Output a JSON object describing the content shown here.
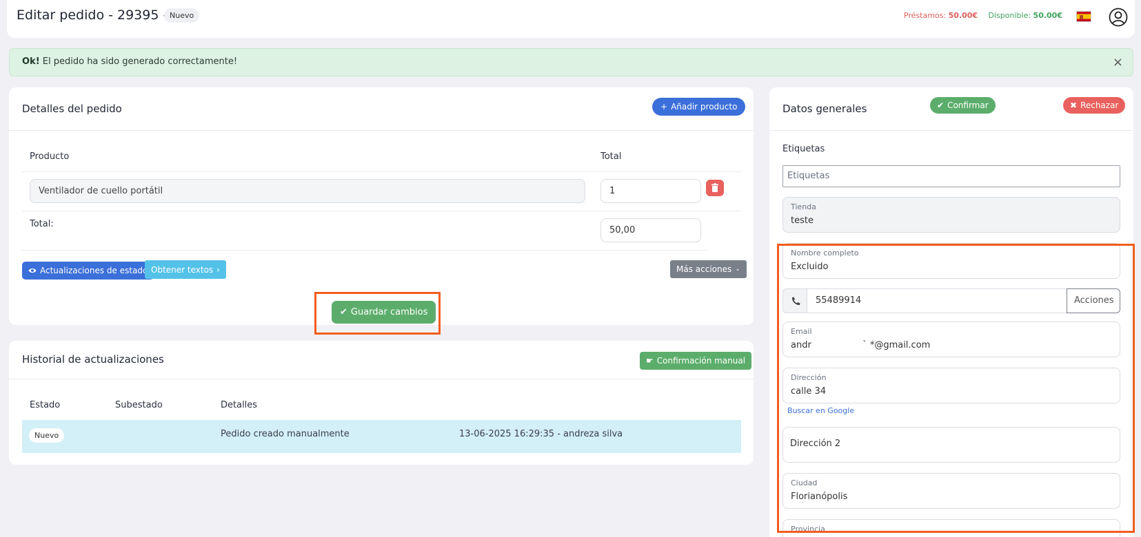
{
  "header": {
    "title": "Editar pedido - 29395 -",
    "status_badge": "Nuevo",
    "loans_label": "Préstamos:",
    "loans_value": "50.00€",
    "available_label": "Disponible:",
    "available_value": "50.00€",
    "flag_icon": "spain-flag-icon",
    "user_icon": "user-circle-icon"
  },
  "alert": {
    "strong": "Ok!",
    "message": "El pedido ha sido generado correctamente!",
    "close": "×"
  },
  "details": {
    "title": "Detalles del pedido",
    "add_product_label": "Añadir producto",
    "col_product": "Producto",
    "col_total": "Total",
    "product_name": "Ventilador de cuello portátil",
    "product_qty": "1",
    "total_label": "Total:",
    "total_value": "50,00",
    "status_updates_label": "Actualizaciones de estado",
    "get_texts_label": "Obtener textos",
    "more_actions_label": "Más acciones",
    "save_label": "Guardar cambios"
  },
  "history": {
    "title": "Historial de actualizaciones",
    "manual_confirm_label": "Confirmación manual",
    "col_state": "Estado",
    "col_substate": "Subestado",
    "col_details": "Detalles",
    "rows": [
      {
        "state": "Nuevo",
        "substate": "",
        "details": "Pedido creado manualmente",
        "meta": "13-06-2025 16:29:35 - andreza silva"
      }
    ]
  },
  "general": {
    "title": "Datos generales",
    "confirm_label": "Confirmar",
    "reject_label": "Rechazar",
    "tags_label": "Etiquetas",
    "tags_placeholder": "Etiquetas",
    "store_label": "Tienda",
    "store_value": "teste",
    "fullname_label": "Nombre completo",
    "fullname_value": "Excluido",
    "phone_value": "55489914",
    "phone_actions": "Acciones",
    "email_label": "Email",
    "email_value": "andr                  ` *@gmail.com",
    "address_label": "Dirección",
    "address_value": "calle 34",
    "google_link": "Buscar en Google",
    "address2_placeholder": "Dirección 2",
    "city_label": "Ciudad",
    "city_value": "Florianópolis",
    "province_label": "Provincia"
  },
  "colors": {
    "accent_blue": "#3b6fd9",
    "success_green": "#5cad6c",
    "danger_red": "#e9615e",
    "info_cyan": "#54c2e8",
    "highlight_orange": "#f25d1f"
  }
}
